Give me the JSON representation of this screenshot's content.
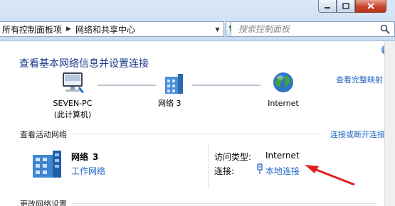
{
  "window": {
    "minimize_icon": "minimize-icon",
    "maximize_icon": "maximize-icon",
    "close_icon": "close-icon"
  },
  "address_bar": {
    "segments": [
      "所有控制面板项",
      "网络和共享中心"
    ]
  },
  "search": {
    "placeholder": "搜索控制面板"
  },
  "main": {
    "title": "查看基本网络信息并设置连接",
    "full_map_link": "查看完整映射",
    "map": {
      "computer_name": "SEVEN-PC",
      "computer_sub": "(此计算机)",
      "network_name": "网络 3",
      "internet_label": "Internet"
    },
    "active_networks": {
      "heading": "查看活动网络",
      "connect_link": "连接或断开连接",
      "network_name": "网络",
      "network_num": "3",
      "network_type": "工作网络",
      "access_type_label": "访问类型:",
      "access_type_value": "Internet",
      "connections_label": "连接:",
      "connections_value": "本地连接"
    },
    "change_settings_heading": "更改网络设置"
  },
  "colors": {
    "link": "#2265c4",
    "title": "#1d3c8c",
    "arrow": "#e02020"
  }
}
